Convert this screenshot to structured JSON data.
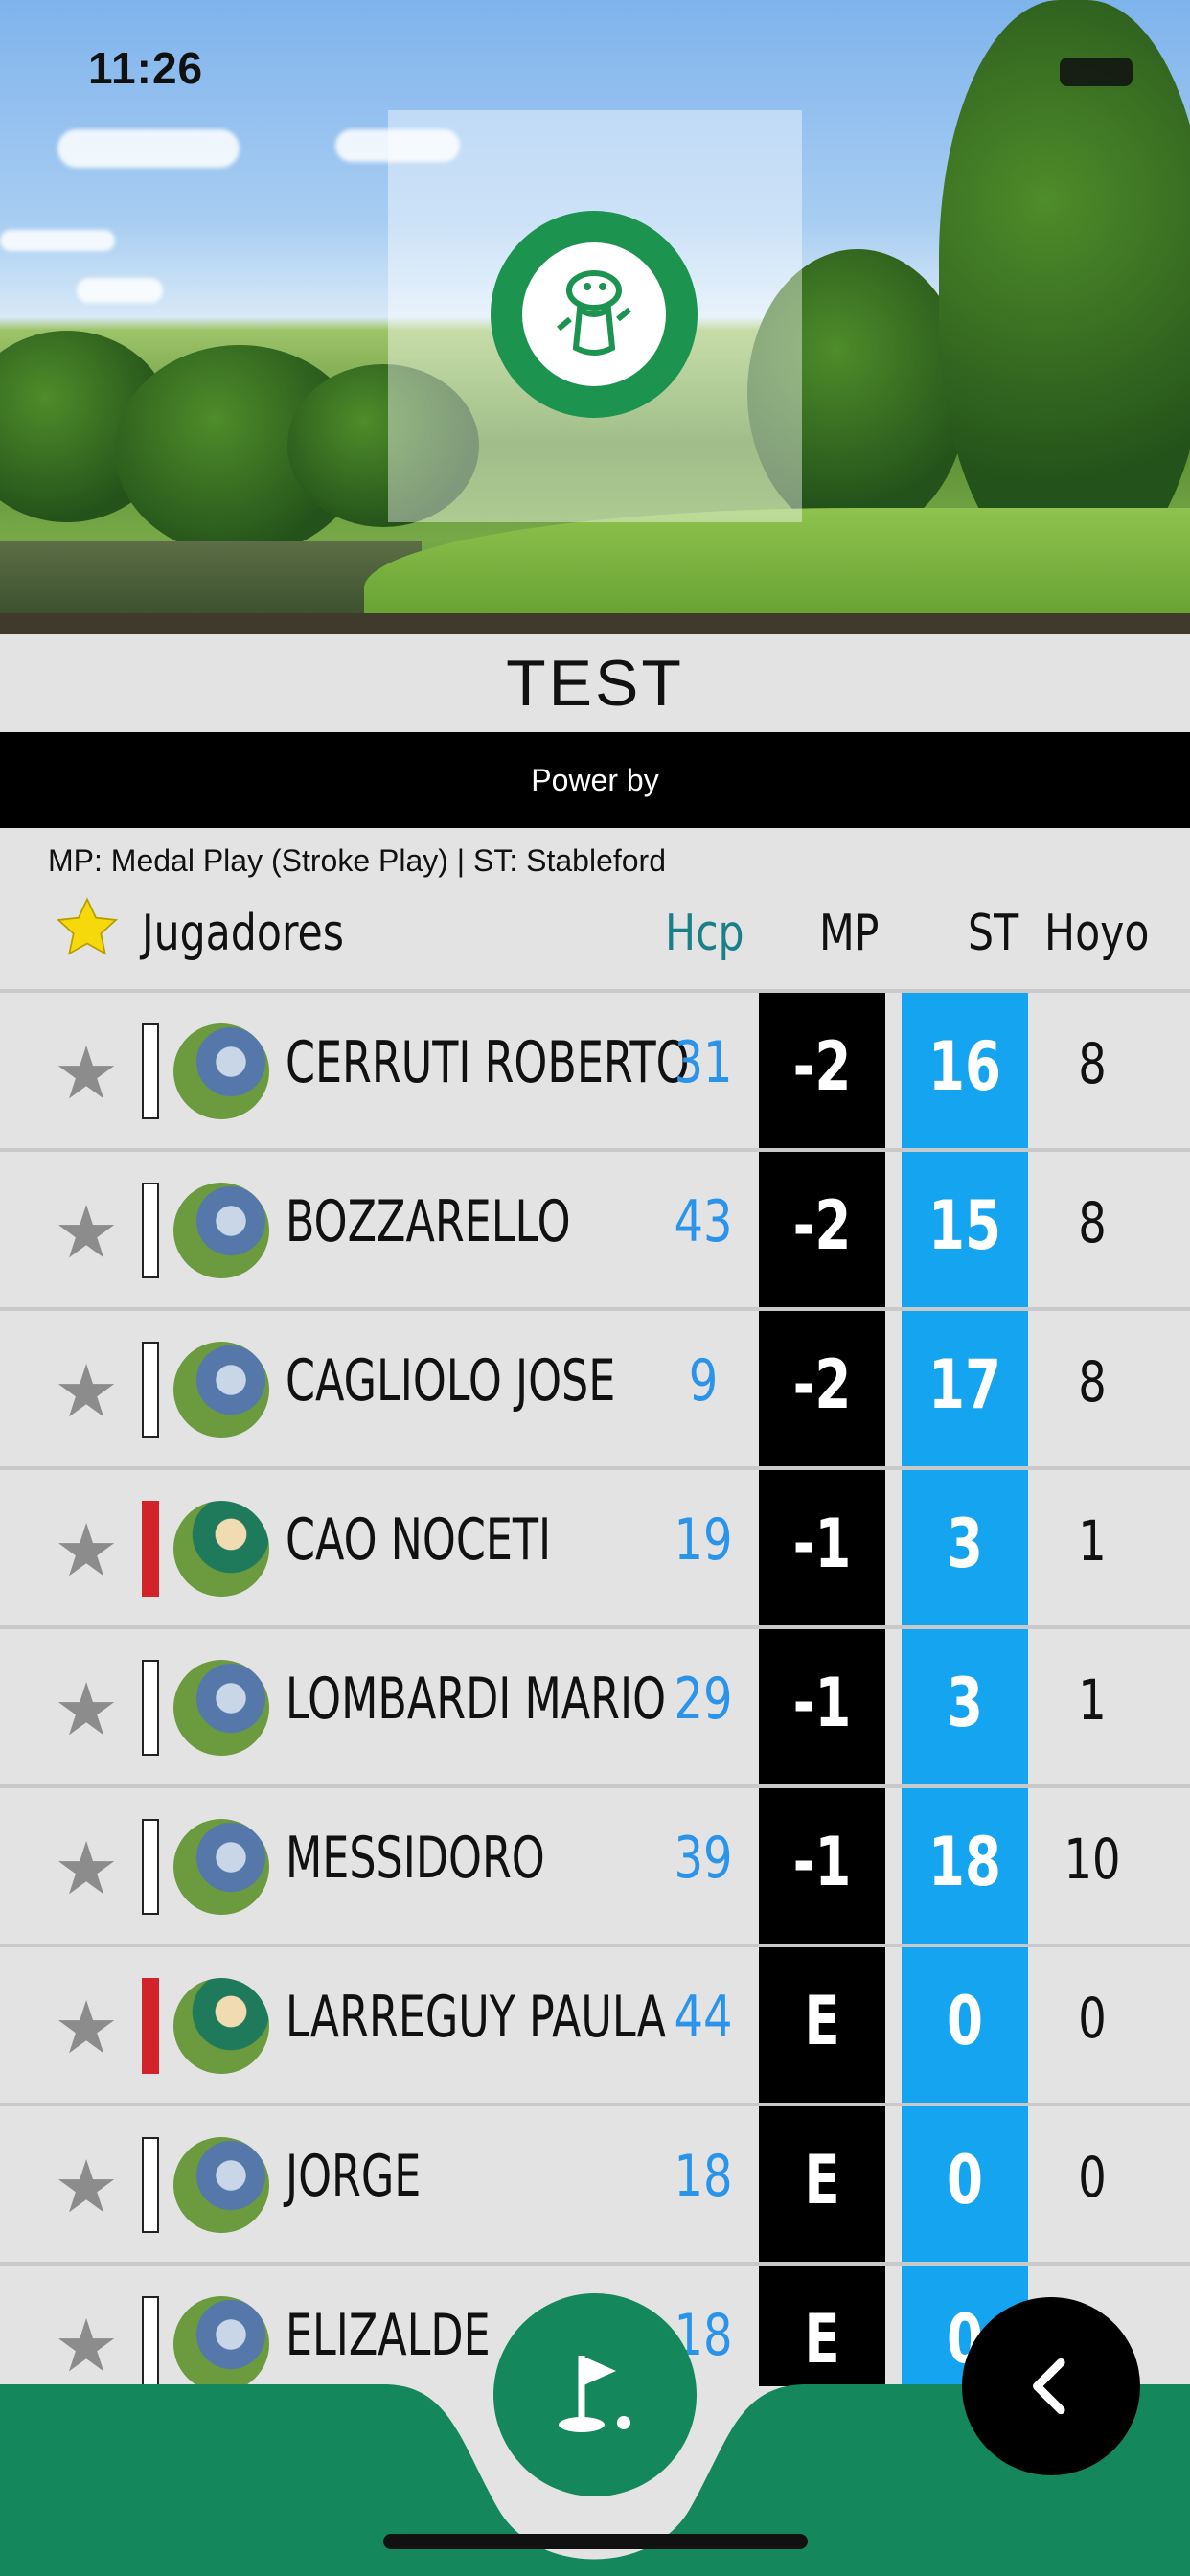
{
  "status_bar": {
    "time": "11:26"
  },
  "header": {
    "title": "TEST",
    "power_label": "Power by",
    "legend": "MP: Medal Play (Stroke Play) | ST: Stableford"
  },
  "table": {
    "columns": {
      "players": "Jugadores",
      "hcp": "Hcp",
      "mp": "MP",
      "st": "ST",
      "hoyo": "Hoyo"
    },
    "rows": [
      {
        "name": "CERRUTI ROBERTO",
        "hcp": "31",
        "mp": "-2",
        "st": "16",
        "hoyo": "8",
        "marker": "white",
        "avatar": "male"
      },
      {
        "name": "BOZZARELLO",
        "hcp": "43",
        "mp": "-2",
        "st": "15",
        "hoyo": "8",
        "marker": "white",
        "avatar": "male"
      },
      {
        "name": "CAGLIOLO JOSE",
        "hcp": "9",
        "mp": "-2",
        "st": "17",
        "hoyo": "8",
        "marker": "white",
        "avatar": "male"
      },
      {
        "name": "CAO NOCETI",
        "hcp": "19",
        "mp": "-1",
        "st": "3",
        "hoyo": "1",
        "marker": "red",
        "avatar": "female"
      },
      {
        "name": "LOMBARDI MARIO",
        "hcp": "29",
        "mp": "-1",
        "st": "3",
        "hoyo": "1",
        "marker": "white",
        "avatar": "male"
      },
      {
        "name": "MESSIDORO",
        "hcp": "39",
        "mp": "-1",
        "st": "18",
        "hoyo": "10",
        "marker": "white",
        "avatar": "male"
      },
      {
        "name": "LARREGUY PAULA",
        "hcp": "44",
        "mp": "E",
        "st": "0",
        "hoyo": "0",
        "marker": "red",
        "avatar": "female"
      },
      {
        "name": "JORGE",
        "hcp": "18",
        "mp": "E",
        "st": "0",
        "hoyo": "0",
        "marker": "white",
        "avatar": "male"
      },
      {
        "name": "ELIZALDE",
        "hcp": "18",
        "mp": "E",
        "st": "0",
        "hoyo": "",
        "marker": "white",
        "avatar": "male"
      }
    ]
  },
  "icons": {
    "favorites_header": "star-icon",
    "row_favorite": "star-icon",
    "golf_button": "golf-flag-icon",
    "back_button": "chevron-left-icon",
    "logo": "los-lagartos-logo"
  },
  "colors": {
    "brand_green": "#14875c",
    "st_column": "#14a4f0",
    "mp_column": "#000000",
    "hcp_text": "#2a94ea",
    "female_marker": "#d2232a",
    "header_star": "#f5d90a"
  }
}
